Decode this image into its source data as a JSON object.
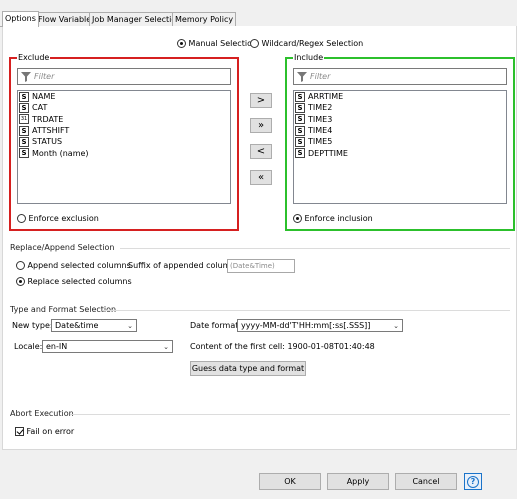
{
  "tabs": [
    "Options",
    "Flow Variables",
    "Job Manager Selection",
    "Memory Policy"
  ],
  "selection_mode": {
    "manual": "Manual Selection",
    "wildcard": "Wildcard/Regex Selection"
  },
  "exclude": {
    "title": "Exclude",
    "filter_placeholder": "Filter",
    "items": [
      {
        "type": "S",
        "label": "NAME"
      },
      {
        "type": "S",
        "label": "CAT"
      },
      {
        "type": "D",
        "label": "TRDATE"
      },
      {
        "type": "S",
        "label": "ATTSHIFT"
      },
      {
        "type": "S",
        "label": "STATUS"
      },
      {
        "type": "S",
        "label": "Month (name)"
      }
    ],
    "enforce_label": "Enforce exclusion",
    "border_color": "#d62020"
  },
  "include": {
    "title": "Include",
    "filter_placeholder": "Filter",
    "items": [
      {
        "type": "S",
        "label": "ARRTIME"
      },
      {
        "type": "S",
        "label": "TIME2"
      },
      {
        "type": "S",
        "label": "TIME3"
      },
      {
        "type": "S",
        "label": "TIME4"
      },
      {
        "type": "S",
        "label": "TIME5"
      },
      {
        "type": "S",
        "label": "DEPTTIME"
      }
    ],
    "enforce_label": "Enforce inclusion",
    "border_color": "#2cc02c"
  },
  "move_buttons": [
    ">",
    "»",
    "<",
    "«"
  ],
  "replace_append": {
    "title": "Replace/Append Selection",
    "append_label": "Append selected columns",
    "replace_label": "Replace selected columns",
    "suffix_label": "Suffix of appended columns:",
    "suffix_placeholder": "(Date&Time)"
  },
  "type_format": {
    "title": "Type and Format Selection",
    "new_type_label": "New type:",
    "new_type_value": "Date&time",
    "date_format_label": "Date format:",
    "date_format_value": "yyyy-MM-dd'T'HH:mm[:ss[.SSS]]",
    "locale_label": "Locale:",
    "locale_value": "en-IN",
    "first_cell_text": "Content of the first cell: 1900-01-08T01:40:48",
    "guess_button": "Guess data type and format"
  },
  "abort": {
    "title": "Abort Execution",
    "fail_label": "Fail on error"
  },
  "footer": {
    "ok": "OK",
    "apply": "Apply",
    "cancel": "Cancel",
    "help": "?"
  },
  "colors": {
    "help_accent": "#1a73c9"
  }
}
